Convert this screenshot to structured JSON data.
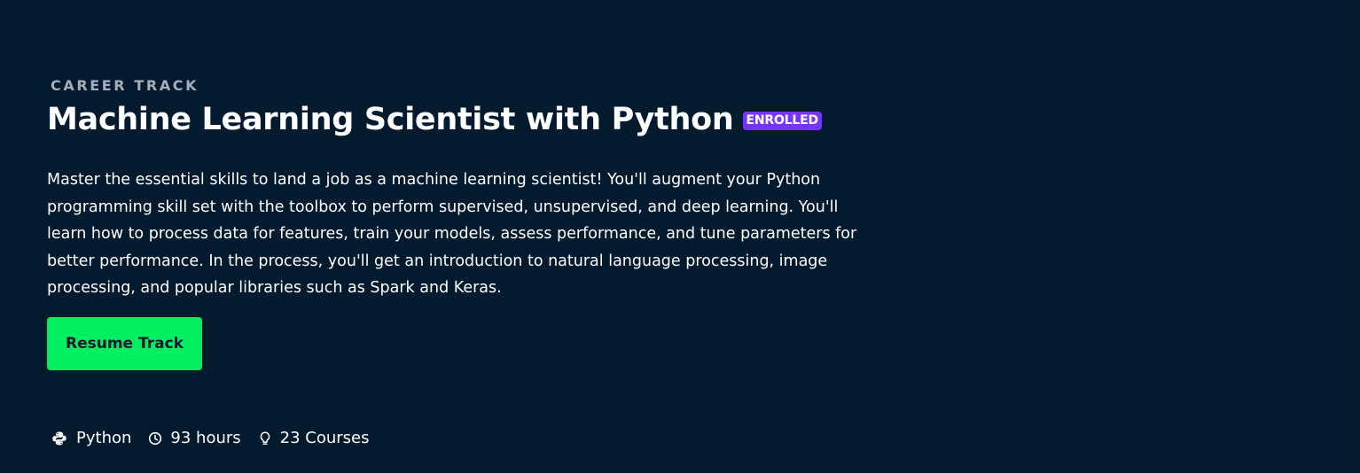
{
  "hero": {
    "eyebrow": "CAREER TRACK",
    "title": "Machine Learning Scientist with Python",
    "badge": "ENROLLED",
    "description": "Master the essential skills to land a job as a machine learning scientist! You'll augment your Python programming skill set with the toolbox to perform supervised, unsupervised, and deep learning. You'll learn how to process data for features, train your models, assess performance, and tune parameters for better performance. In the process, you'll get an introduction to natural language processing, image processing, and popular libraries such as Spark and Keras.",
    "resume_label": "Resume Track"
  },
  "meta": {
    "technology": {
      "icon": "python-icon",
      "label": "Python"
    },
    "duration": {
      "icon": "clock-icon",
      "label": "93 hours"
    },
    "courses": {
      "icon": "lightbulb-icon",
      "label": "23 Courses"
    }
  },
  "colors": {
    "background": "#031a2f",
    "accent_green": "#03ef62",
    "badge_purple": "#7933ff",
    "eyebrow_gray": "#a6aeb7",
    "text": "#ffffff"
  }
}
